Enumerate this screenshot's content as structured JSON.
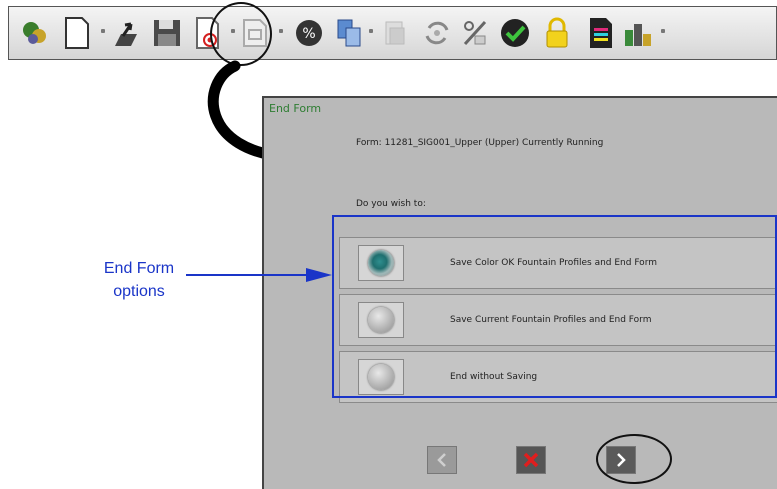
{
  "toolbar": {
    "icons": [
      "jobs-icon",
      "new-document-icon",
      "export-icon",
      "save-icon",
      "end-form-icon",
      "preview-icon",
      "percent-icon",
      "copy-icon",
      "print-icon",
      "refresh-icon",
      "edit-icon",
      "color-ok-icon",
      "lock-icon",
      "report-icon",
      "tools-icon"
    ]
  },
  "dialog": {
    "title": "End Form",
    "form_line": "Form: 11281_SIG001_Upper (Upper) Currently Running",
    "prompt": "Do you wish to:",
    "options": [
      {
        "label": "Save Color OK Fountain Profiles and End Form",
        "selected": true
      },
      {
        "label": "Save Current Fountain Profiles and End Form",
        "selected": false
      },
      {
        "label": "End without Saving",
        "selected": false
      }
    ],
    "buttons": [
      "back-button",
      "cancel-button",
      "next-button"
    ]
  },
  "callout": {
    "line1": "End Form",
    "line2": "options"
  },
  "colors": {
    "annotation_blue": "#1a35c8",
    "dialog_bg": "#b9b9b9",
    "title_green": "#2e7d32",
    "selected_teal": "#1f6f6f"
  }
}
